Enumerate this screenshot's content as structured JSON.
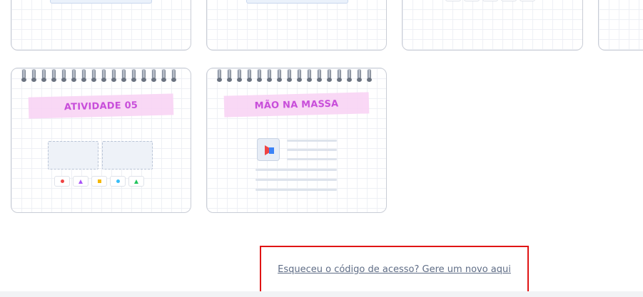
{
  "activities": [
    {
      "title": "ATIVIDADE 05",
      "shapes": [
        "red-circle",
        "purple-triangle",
        "yellow-square",
        "blue-circle",
        "green-triangle"
      ]
    },
    {
      "title": "MÃO NA MASSA"
    }
  ],
  "icons": {
    "play": "play-triangle-icon",
    "shapes": [
      "red-circle-icon",
      "purple-triangle-icon",
      "yellow-square-icon",
      "blue-circle-icon",
      "green-triangle-icon"
    ]
  },
  "colors": {
    "label": "#c33bd6",
    "tape": "#f9d4f5",
    "play": "#3ab0e6",
    "red": "#ef4444",
    "yellow": "#f5b800",
    "blue": "#38bdf8",
    "purple": "#a855f7",
    "green": "#22c55e",
    "highlight_border": "#e01414"
  },
  "access_link": {
    "text": "Esqueceu o código de acesso? Gere um novo aqui"
  }
}
